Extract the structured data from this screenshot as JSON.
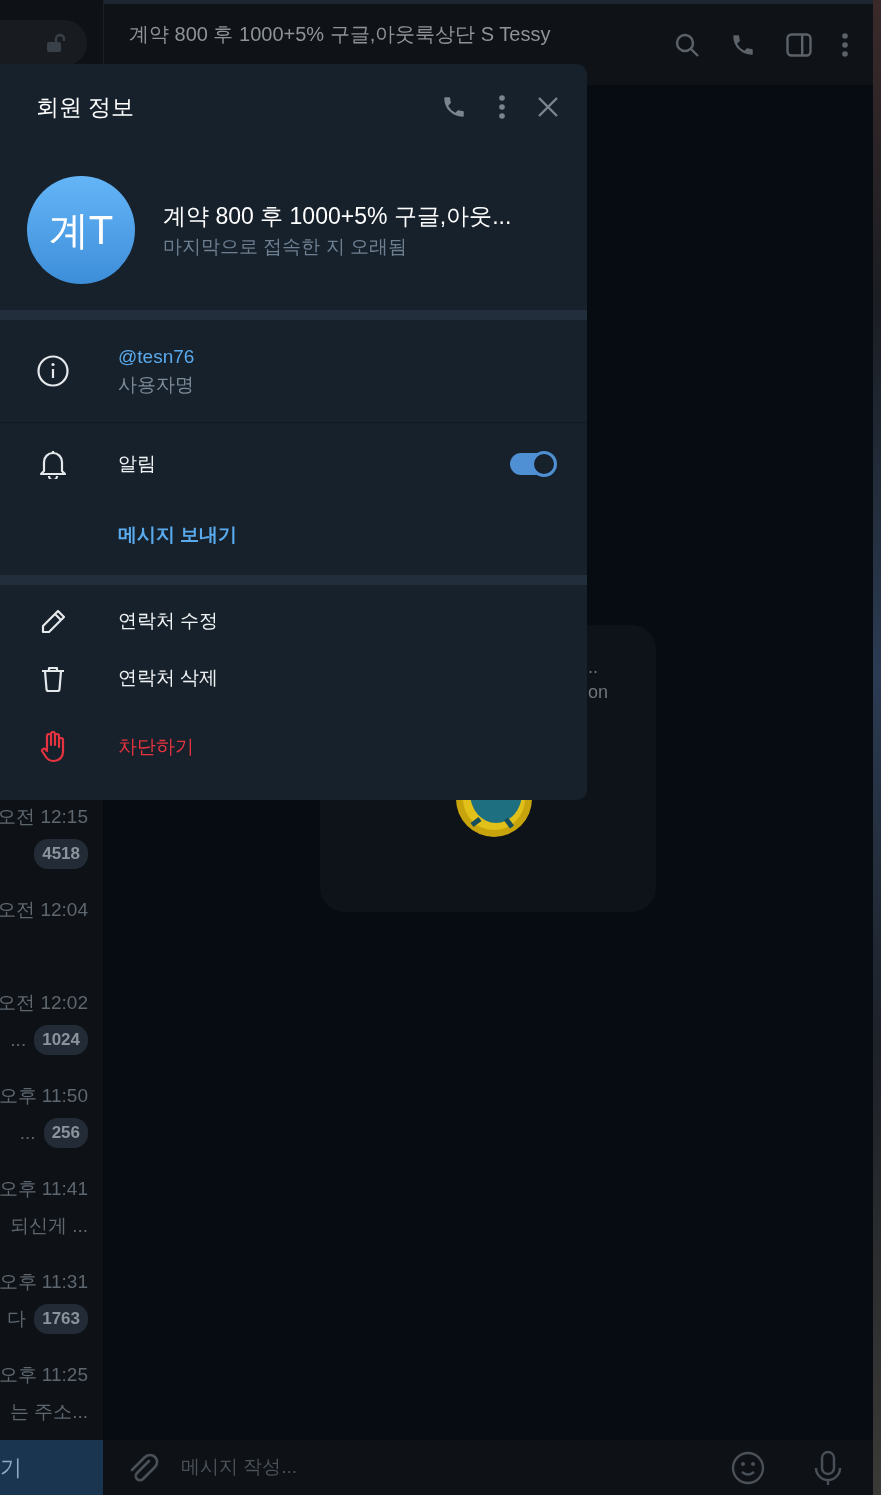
{
  "header": {
    "title": "계약 800 후 1000+5% 구글,아웃룩상단 S Tessy"
  },
  "sidebar": {
    "chats": [
      {
        "time": "오전 12:15",
        "badge": "4518"
      },
      {
        "time": "오전 12:04"
      },
      {
        "time": "오전 12:02",
        "snippet": "...",
        "badge": "1024"
      },
      {
        "time": "오후 11:50",
        "snippet": "...",
        "badge": "256"
      },
      {
        "time": "오후 11:41",
        "snippet": "되신게 ..."
      },
      {
        "time": "오후 11:31",
        "snippet": "다",
        "badge": "1763"
      },
      {
        "time": "오후 11:25",
        "snippet": "는 주소..."
      }
    ],
    "footer_label": "기"
  },
  "chat": {
    "bubble_texts": [
      "..",
      "on"
    ]
  },
  "profile_panel": {
    "title": "회원 정보",
    "avatar_initials": "계T",
    "name": "계약 800 후 1000+5% 구글,아웃...",
    "status": "마지막으로 접속한 지 오래됨",
    "info": [
      {
        "kind": "username",
        "value": "@tesn76",
        "label": "사용자명"
      },
      {
        "kind": "notifications",
        "label": "알림",
        "on": true
      }
    ],
    "send_message": "메시지 보내기",
    "actions": [
      {
        "kind": "edit",
        "label": "연락처 수정"
      },
      {
        "kind": "delete",
        "label": "연락처 삭제"
      },
      {
        "kind": "block",
        "label": "차단하기"
      }
    ]
  },
  "composer": {
    "placeholder": "메시지 작성..."
  }
}
